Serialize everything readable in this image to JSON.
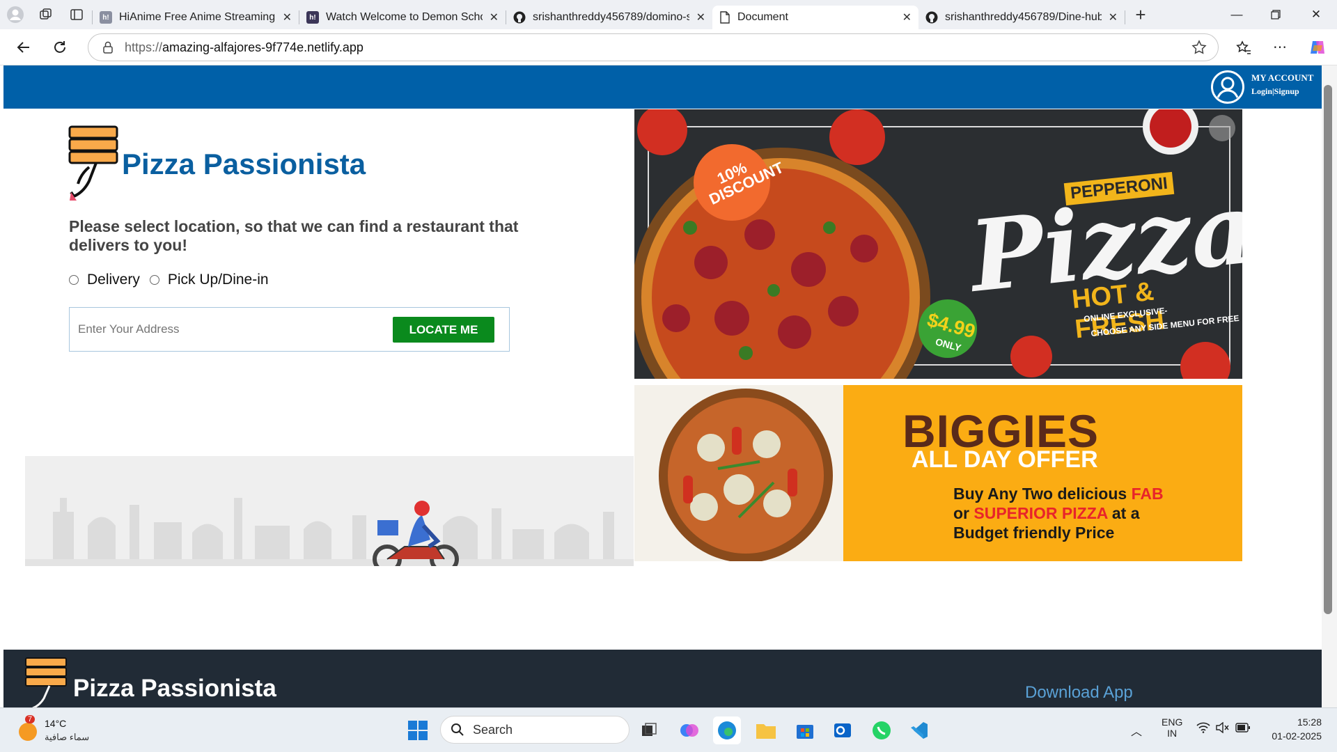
{
  "browser": {
    "tabs": [
      {
        "title": "HiAnime Free Anime Streaming H",
        "favicon": "h!"
      },
      {
        "title": "Watch Welcome to Demon Schoo",
        "favicon": "h!"
      },
      {
        "title": "srishanthreddy456789/domino-s",
        "favicon": "github"
      },
      {
        "title": "Document",
        "favicon": "page",
        "active": true
      },
      {
        "title": "srishanthreddy456789/Dine-hub",
        "favicon": "github"
      }
    ],
    "url_prefix": "https://",
    "url_host": "amazing-alfajores-9f774e.netlify.app"
  },
  "site": {
    "account_title": "MY ACCOUNT",
    "account_sub": "Login|Signup",
    "brand": "Pizza Passionista",
    "headline": "Please select location, so that we can find a restaurant that delivers to you!",
    "options": [
      "Delivery",
      "Pick Up/Dine-in"
    ],
    "address_placeholder": "Enter Your Address",
    "locate_label": "LOCATE ME"
  },
  "banner1": {
    "discount": "10% DISCOUNT",
    "tag": "PEPPERONI",
    "word": "Pizza",
    "sub": "HOT & FRESH",
    "note1": "ONLINE EXCLUSIVE-",
    "note2": "CHOOSE ANY SIDE MENU FOR FREE",
    "price": "$4.99",
    "price_note": "ONLY"
  },
  "banner2": {
    "title": "BIGGIES",
    "subtitle": "ALL DAY OFFER",
    "line1a": "Buy Any Two delicious ",
    "line1b": "FAB",
    "line2a": "or ",
    "line2b": "SUPERIOR PIZZA",
    "line2c": " at a",
    "line3": "Budget friendly Price"
  },
  "footer": {
    "brand": "Pizza Passionista",
    "download": "Download App"
  },
  "taskbar": {
    "weather_temp": "14°C",
    "weather_desc": "سماء صافية",
    "weather_badge": "7",
    "search_label": "Search",
    "lang1": "ENG",
    "lang2": "IN",
    "time": "15:28",
    "date": "01-02-2025"
  },
  "colors": {
    "nav_blue": "#0060a8",
    "locate_green": "#0a8a1d",
    "footer_dark": "#212b36",
    "banner_orange": "#fbac13"
  }
}
